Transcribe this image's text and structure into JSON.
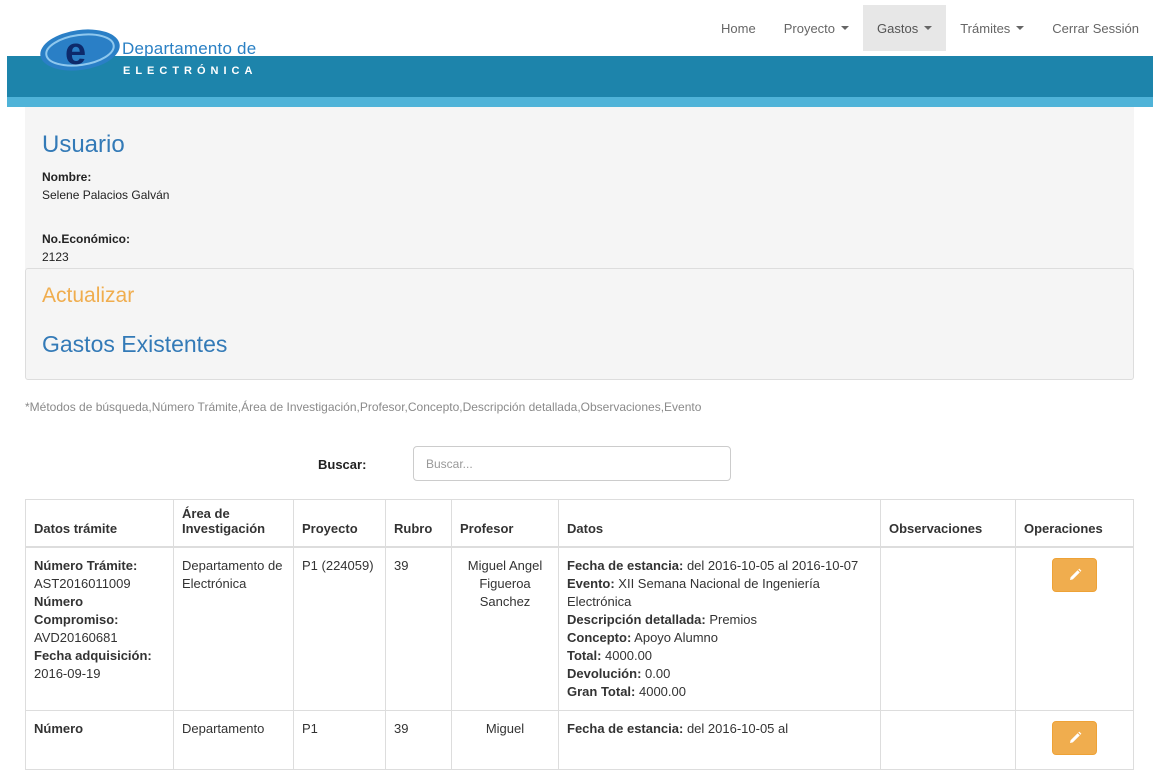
{
  "logo": {
    "letter": "e",
    "line1": "Departamento de",
    "line2": "ELECTRÓNICA"
  },
  "nav": {
    "items": [
      {
        "label": "Home",
        "dropdown": false,
        "active": false
      },
      {
        "label": "Proyecto",
        "dropdown": true,
        "active": false
      },
      {
        "label": "Gastos",
        "dropdown": true,
        "active": true
      },
      {
        "label": "Trámites",
        "dropdown": true,
        "active": false
      },
      {
        "label": "Cerrar Sessión",
        "dropdown": false,
        "active": false
      }
    ]
  },
  "user": {
    "title": "Usuario",
    "name_label": "Nombre:",
    "name_value": "Selene Palacios Galván",
    "econ_label": "No.Económico:",
    "econ_value": "2123"
  },
  "gastos": {
    "action": "Actualizar",
    "title": "Gastos Existentes",
    "hint": "*Métodos de búsqueda,Número Trámite,Área de Investigación,Profesor,Concepto,Descripción detallada,Observaciones,Evento",
    "search_label": "Buscar:",
    "search_placeholder": "Buscar...",
    "search_value": ""
  },
  "table": {
    "headers": [
      "Datos trámite",
      "Área de Investigación",
      "Proyecto",
      "Rubro",
      "Profesor",
      "Datos",
      "Observaciones",
      "Operaciones"
    ],
    "rows": [
      {
        "tramite_label": "Número Trámite:",
        "tramite": "AST2016011009",
        "compromiso_label": "Número Compromiso:",
        "compromiso": "AVD20160681",
        "fecha_label": "Fecha adquisición:",
        "fecha": "2016-09-19",
        "area": "Departamento de Electrónica",
        "proyecto": "P1 (224059)",
        "rubro": "39",
        "profesor": "Miguel Angel Figueroa Sanchez",
        "estancia_label": "Fecha de estancia:",
        "estancia": " del 2016-10-05 al 2016-10-07",
        "evento_label": "Evento:",
        "evento": " XII Semana Nacional de Ingeniería Electrónica",
        "descripcion_label": "Descripción detallada:",
        "descripcion": " Premios",
        "concepto_label": "Concepto:",
        "concepto": " Apoyo Alumno",
        "total_label": "Total:",
        "total": " 4000.00",
        "devolucion_label": "Devolución:",
        "devolucion": " 0.00",
        "gran_total_label": "Gran Total:",
        "gran_total": " 4000.00",
        "observaciones": "",
        "edit_icon": "pencil-icon"
      },
      {
        "tramite_label": "Número",
        "area": "Departamento",
        "proyecto": "P1",
        "rubro": "39",
        "profesor": "Miguel",
        "estancia_label": "Fecha de estancia:",
        "estancia": " del 2016-10-05 al",
        "edit_icon": "pencil-icon"
      }
    ]
  },
  "colors": {
    "brand_blue": "#1d84ab",
    "brand_light_blue": "#4fb3d8",
    "link_blue": "#337ab7",
    "warning_orange": "#f0ad4e"
  }
}
